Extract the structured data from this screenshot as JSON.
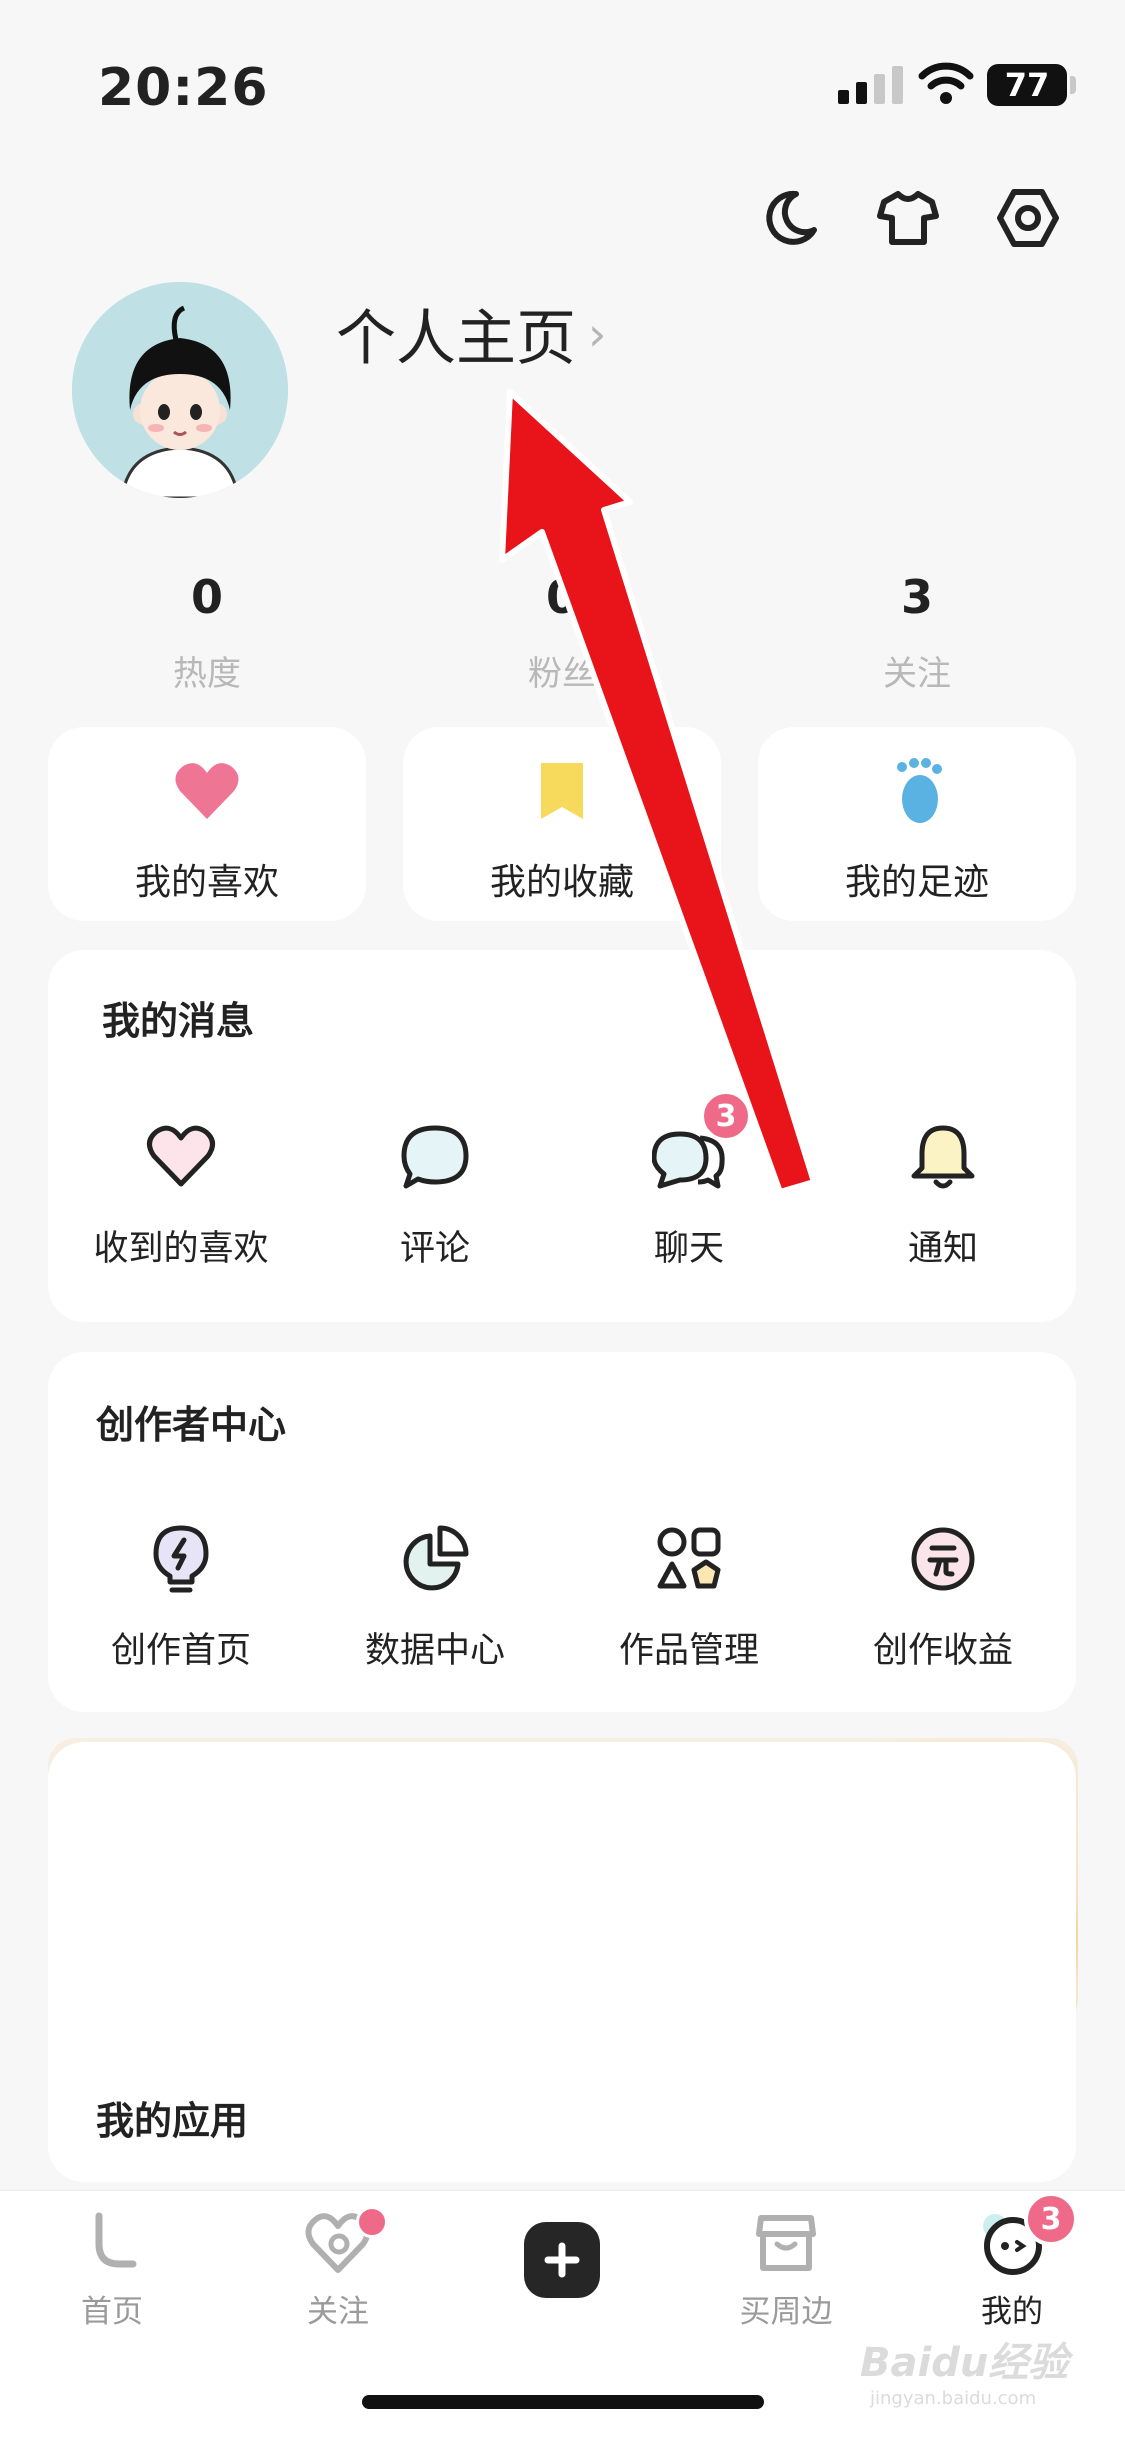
{
  "status_bar": {
    "time": "20:26",
    "battery": "77"
  },
  "profile": {
    "title": "个人主页",
    "chevron": "›"
  },
  "stats": [
    {
      "value": "0",
      "label": "热度"
    },
    {
      "value": "0",
      "label": "粉丝"
    },
    {
      "value": "3",
      "label": "关注"
    }
  ],
  "quick_cards": [
    {
      "label": "我的喜欢",
      "icon": "heart-icon",
      "color": "#ee7593"
    },
    {
      "label": "我的收藏",
      "icon": "bookmark-icon",
      "color": "#f7d95c"
    },
    {
      "label": "我的足迹",
      "icon": "footprint-icon",
      "color": "#5ab2e3"
    }
  ],
  "messages": {
    "title": "我的消息",
    "items": [
      {
        "label": "收到的喜欢",
        "icon": "heart-outline-icon"
      },
      {
        "label": "评论",
        "icon": "comment-icon"
      },
      {
        "label": "聊天",
        "icon": "chat-icon",
        "badge": "3"
      },
      {
        "label": "通知",
        "icon": "bell-icon"
      }
    ]
  },
  "creator": {
    "title": "创作者中心",
    "items": [
      {
        "label": "创作首页",
        "icon": "lightbulb-icon"
      },
      {
        "label": "数据中心",
        "icon": "pie-chart-icon"
      },
      {
        "label": "作品管理",
        "icon": "shapes-grid-icon"
      },
      {
        "label": "创作收益",
        "icon": "yuan-coin-icon"
      }
    ]
  },
  "apps": {
    "title": "我的应用"
  },
  "bottom_nav": {
    "items": [
      {
        "label": "首页",
        "icon": "home-icon"
      },
      {
        "label": "关注",
        "icon": "follow-heart-icon"
      },
      {
        "label": "",
        "icon": "plus-icon"
      },
      {
        "label": "买周边",
        "icon": "shop-icon"
      },
      {
        "label": "我的",
        "icon": "me-face-icon",
        "badge": "3"
      }
    ]
  },
  "watermark": {
    "text": "Baidu经验",
    "sub": "jingyan.baidu.com"
  },
  "colors": {
    "accent_badge": "#ef6a88",
    "arrow": "#e8141a",
    "background": "#f7f7f7"
  }
}
